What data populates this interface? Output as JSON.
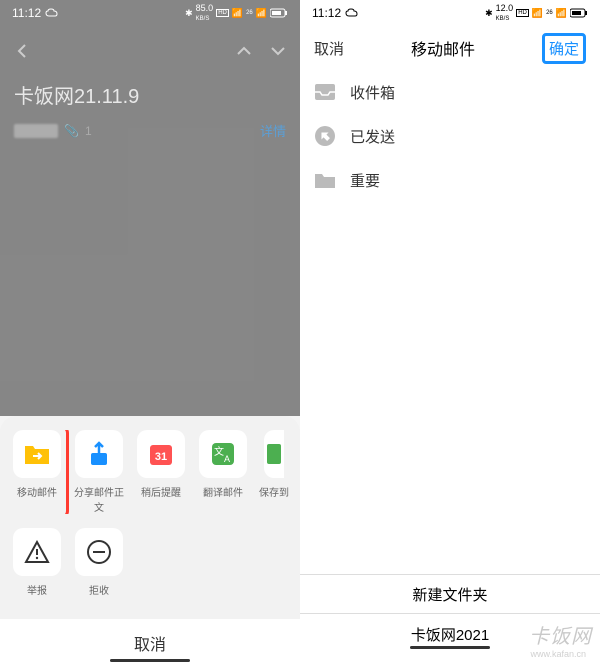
{
  "status": {
    "time": "11:12",
    "speed_left": "85.0",
    "speed_right": "12.0",
    "speed_unit": "KB/S"
  },
  "left": {
    "subject": "卡饭网21.11.9",
    "attachment_count": "1",
    "detail_label": "详情",
    "actions": [
      {
        "label": "移动邮件"
      },
      {
        "label": "分享邮件正文"
      },
      {
        "label": "稍后提醒"
      },
      {
        "label": "翻译邮件"
      },
      {
        "label": "保存到"
      }
    ],
    "actions2": [
      {
        "label": "举报"
      },
      {
        "label": "拒收"
      }
    ],
    "cancel": "取消"
  },
  "right": {
    "cancel": "取消",
    "title": "移动邮件",
    "confirm": "确定",
    "folders": [
      {
        "label": "收件箱"
      },
      {
        "label": "已发送"
      },
      {
        "label": "重要"
      }
    ],
    "new_folder": "新建文件夹",
    "selected_folder": "卡饭网2021"
  },
  "watermark": {
    "text": "卡饭网",
    "url": "www.kafan.cn"
  }
}
